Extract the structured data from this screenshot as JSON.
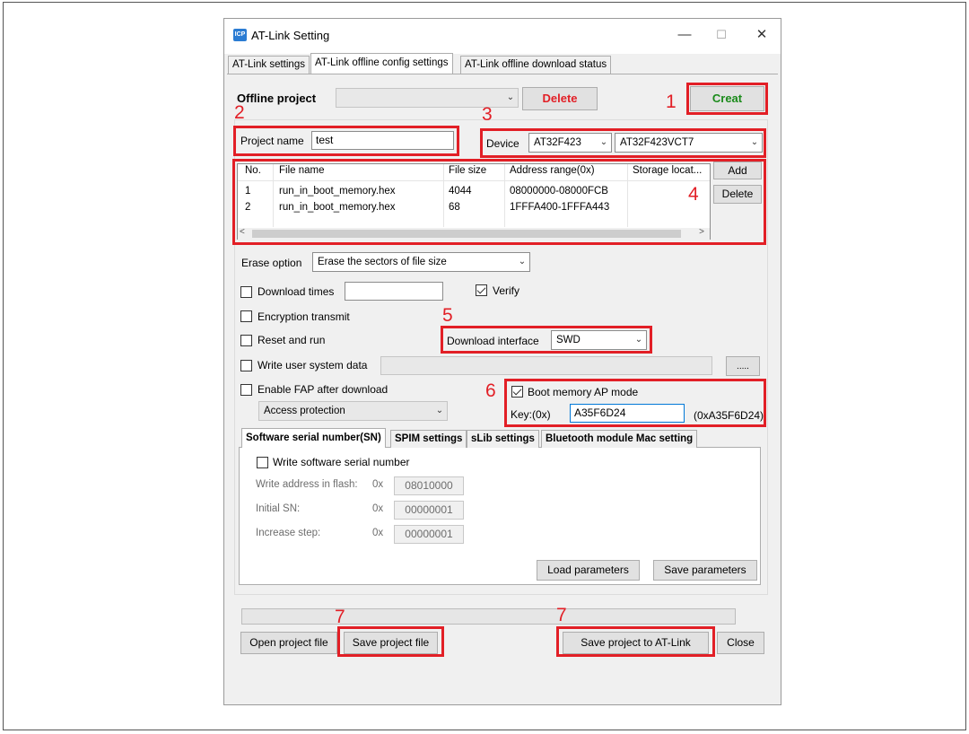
{
  "window": {
    "title": "AT-Link Setting",
    "icon_text": "ICP",
    "controls": {
      "minimize": "—",
      "maximize": "☐",
      "close": "✕"
    }
  },
  "tabs": [
    {
      "label": "AT-Link settings",
      "active": false
    },
    {
      "label": "AT-Link offline config settings",
      "active": true
    },
    {
      "label": "AT-Link offline download status",
      "active": false
    }
  ],
  "offline_project": {
    "label": "Offline project",
    "value": "",
    "delete_label": "Delete",
    "creat_label": "Creat"
  },
  "project_name": {
    "label": "Project name",
    "value": "test"
  },
  "device": {
    "label": "Device",
    "family": "AT32F423",
    "model": "AT32F423VCT7"
  },
  "files": {
    "headers": [
      "No.",
      "File name",
      "File size",
      "Address range(0x)",
      "Storage locat..."
    ],
    "rows": [
      {
        "no": "1",
        "name": "run_in_boot_memory.hex",
        "size": "4044",
        "range": "08000000-08000FCB",
        "storage": ""
      },
      {
        "no": "2",
        "name": "run_in_boot_memory.hex",
        "size": "68",
        "range": "1FFFA400-1FFFA443",
        "storage": ""
      }
    ],
    "add_label": "Add",
    "delete_label": "Delete"
  },
  "erase": {
    "label": "Erase option",
    "value": "Erase the sectors of file size"
  },
  "options": {
    "download_times": {
      "label": "Download times",
      "checked": false,
      "value": ""
    },
    "verify": {
      "label": "Verify",
      "checked": true
    },
    "encryption": {
      "label": "Encryption transmit",
      "checked": false
    },
    "reset_run": {
      "label": "Reset and run",
      "checked": false
    },
    "write_user_system": {
      "label": "Write user system data",
      "checked": false,
      "browse_label": "....."
    },
    "enable_fap": {
      "label": "Enable FAP after download",
      "checked": false,
      "value": "Access protection"
    }
  },
  "download_interface": {
    "label": "Download interface",
    "value": "SWD"
  },
  "boot_memory": {
    "label": "Boot memory AP mode",
    "checked": true,
    "key_label": "Key:(0x)",
    "key_value": "A35F6D24",
    "key_display": "(0xA35F6D24)"
  },
  "subtabs": [
    {
      "label": "Software serial number(SN)",
      "active": true
    },
    {
      "label": "SPIM settings",
      "active": false
    },
    {
      "label": "sLib settings",
      "active": false
    },
    {
      "label": "Bluetooth module Mac setting",
      "active": false
    }
  ],
  "serial": {
    "write_label": "Write software serial number",
    "write_checked": false,
    "address_label": "Write address in flash:",
    "address_prefix": "0x",
    "address_value": "08010000",
    "initial_label": "Initial SN:",
    "initial_prefix": "0x",
    "initial_value": "00000001",
    "step_label": "Increase step:",
    "step_prefix": "0x",
    "step_value": "00000001"
  },
  "params": {
    "load_label": "Load parameters",
    "save_label": "Save parameters"
  },
  "progress": {
    "value": 0
  },
  "footer": {
    "open_label": "Open project file",
    "save_label": "Save project file",
    "save_atlink_label": "Save project to AT-Link",
    "close_label": "Close"
  },
  "annotations": [
    "1",
    "2",
    "3",
    "4",
    "5",
    "6",
    "7",
    "7"
  ],
  "colors": {
    "highlight_red": "#e21f26",
    "creat_green": "#1a8a1a",
    "delete_red": "#e21f26"
  }
}
